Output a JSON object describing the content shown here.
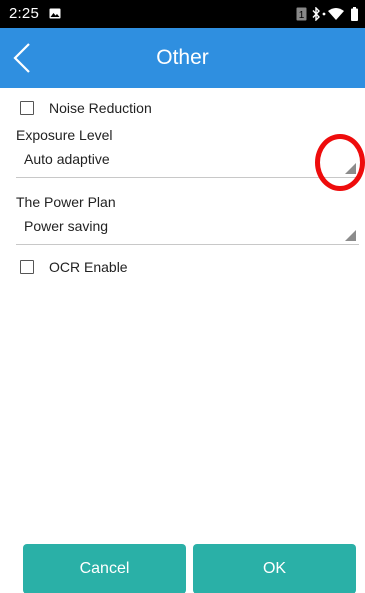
{
  "status_bar": {
    "time": "2:25",
    "sim_slot": "1"
  },
  "app_bar": {
    "title": "Other"
  },
  "settings": {
    "noise_reduction": {
      "label": "Noise Reduction",
      "checked": false
    },
    "exposure_level": {
      "label": "Exposure Level",
      "value": "Auto adaptive"
    },
    "power_plan": {
      "label": "The Power Plan",
      "value": "Power saving"
    },
    "ocr_enable": {
      "label": "OCR Enable",
      "checked": false
    }
  },
  "buttons": {
    "cancel": "Cancel",
    "ok": "OK"
  },
  "colors": {
    "app_bar": "#2f8fe0",
    "button": "#2ab0a7",
    "annotation": "#ee0c0c"
  }
}
